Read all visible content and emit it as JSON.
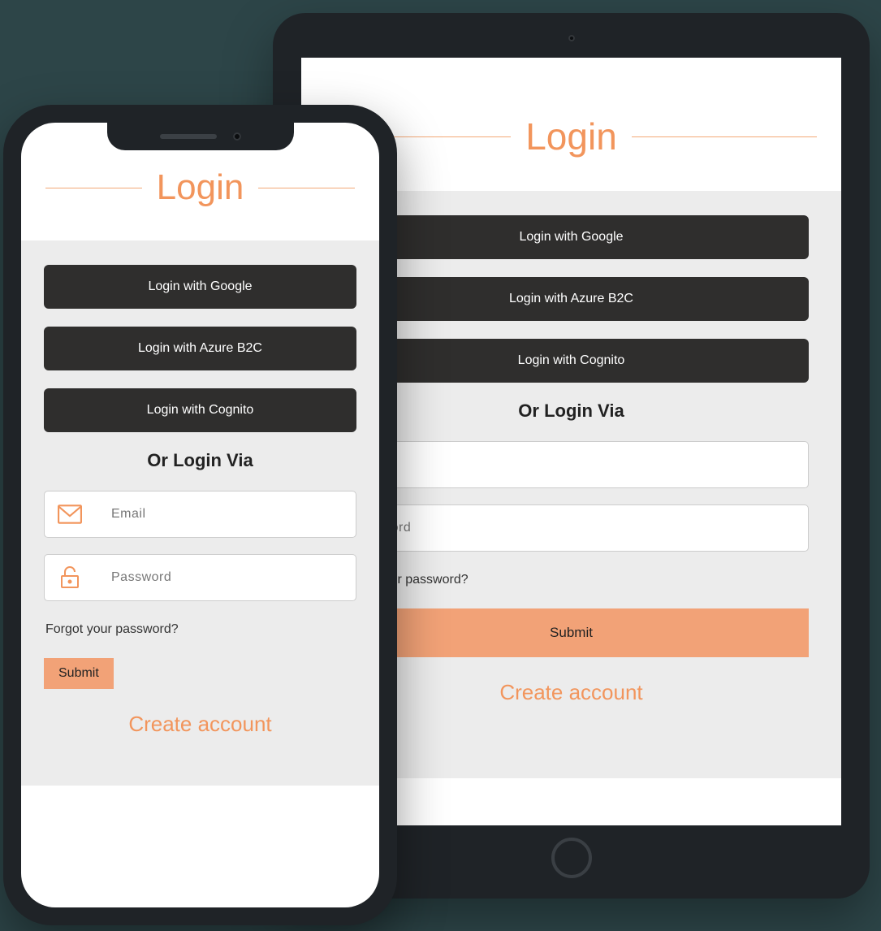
{
  "login": {
    "title": "Login",
    "providers": [
      {
        "label": "Login with Google"
      },
      {
        "label": "Login with Azure B2C"
      },
      {
        "label": "Login with Cognito"
      }
    ],
    "or_heading": "Or Login Via",
    "email_placeholder": "Email",
    "password_placeholder": "Password",
    "forgot_label": "Forgot your password?",
    "submit_label": "Submit",
    "create_label": "Create account"
  },
  "colors": {
    "accent": "#f2955c",
    "accent_fill": "#f2a277",
    "dark_button": "#2f2e2d",
    "card_bg": "#ececec"
  }
}
